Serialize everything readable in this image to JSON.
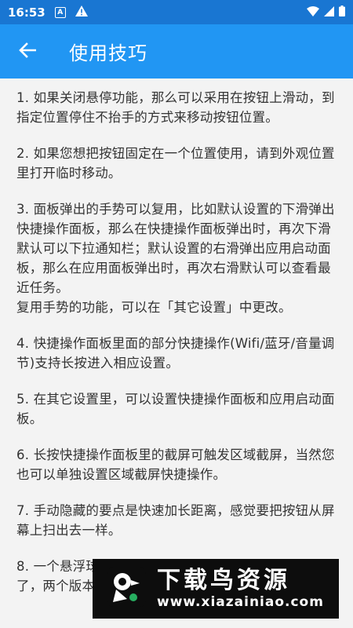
{
  "status_bar": {
    "time": "16:53",
    "notif_a": "A"
  },
  "app_bar": {
    "title": "使用技巧"
  },
  "tips": [
    {
      "paragraphs": [
        "1. 如果关闭悬停功能，那么可以采用在按钮上滑动，到指定位置停住不抬手的方式来移动按钮位置。"
      ]
    },
    {
      "paragraphs": [
        "2. 如果您想把按钮固定在一个位置使用，请到外观位置里打开临时移动。"
      ]
    },
    {
      "paragraphs": [
        "3. 面板弹出的手势可以复用，比如默认设置的下滑弹出快捷操作面板，那么在快捷操作面板弹出时，再次下滑默认可以下拉通知栏；默认设置的右滑弹出应用启动面板，那么在应用面板弹出时，再次右滑默认可以查看最近任务。",
        "复用手势的功能，可以在「其它设置」中更改。"
      ]
    },
    {
      "paragraphs": [
        "4. 快捷操作面板里面的部分快捷操作(Wifi/蓝牙/音量调节)支持长按进入相应设置。"
      ]
    },
    {
      "paragraphs": [
        "5. 在其它设置里，可以设置快捷操作面板和应用启动面板。"
      ]
    },
    {
      "paragraphs": [
        "6. 长按快捷操作面板里的截屏可触发区域截屏，当然您也可以单独设置区域截屏快捷操作。"
      ]
    },
    {
      "paragraphs": [
        "7. 手动隐藏的要点是快速加长距离，感觉要把按钮从屏幕上扫出去一样。"
      ]
    },
    {
      "paragraphs": [
        "8. 一个悬浮球",
        "了，两个版本"
      ]
    }
  ],
  "watermark": {
    "name": "下载鸟资源",
    "url": "www.xiazainiao.com"
  }
}
